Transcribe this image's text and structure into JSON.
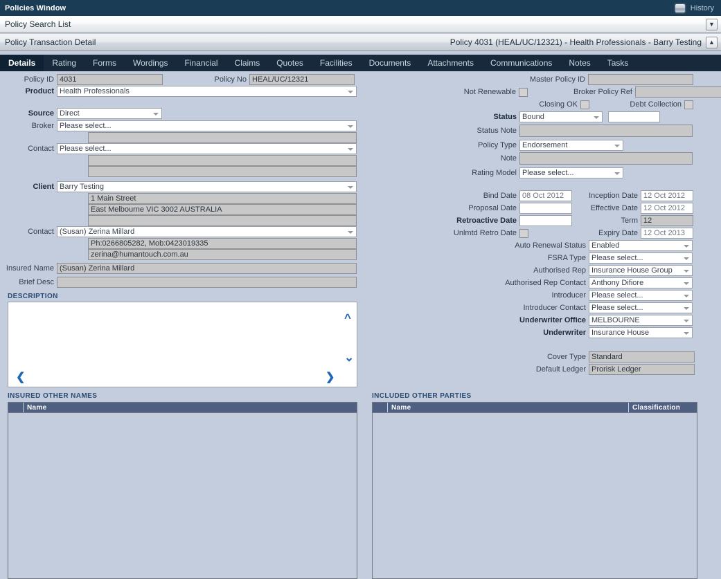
{
  "window": {
    "title": "Policies Window",
    "history_label": "History",
    "history_icon": "window-icon"
  },
  "breadcrumbs": {
    "search_list": "Policy Search List",
    "transaction_detail": "Policy Transaction Detail",
    "policy_title": "Policy 4031 (HEAL/UC/12321) - Health Professionals - Barry Testing",
    "expand_down_icon": "chevron-down-icon",
    "collapse_up_icon": "chevron-up-icon"
  },
  "tabs": [
    {
      "label": "Details",
      "active": true
    },
    {
      "label": "Rating",
      "active": false
    },
    {
      "label": "Forms",
      "active": false
    },
    {
      "label": "Wordings",
      "active": false
    },
    {
      "label": "Financial",
      "active": false
    },
    {
      "label": "Claims",
      "active": false
    },
    {
      "label": "Quotes",
      "active": false
    },
    {
      "label": "Facilities",
      "active": false
    },
    {
      "label": "Documents",
      "active": false
    },
    {
      "label": "Attachments",
      "active": false
    },
    {
      "label": "Communications",
      "active": false
    },
    {
      "label": "Notes",
      "active": false
    },
    {
      "label": "Tasks",
      "active": false
    }
  ],
  "left": {
    "policy_id_label": "Policy ID",
    "policy_id_value": "4031",
    "policy_no_label": "Policy No",
    "policy_no_value": "HEAL/UC/12321",
    "product_label": "Product",
    "product_value": "Health Professionals",
    "source_label": "Source",
    "source_value": "Direct",
    "broker_label": "Broker",
    "broker_value": "Please select...",
    "broker_detail_1": "",
    "contact_label": "Contact",
    "contact_value": "Please select...",
    "contact_detail_1": "",
    "contact_detail_2": "",
    "client_label": "Client",
    "client_value": "Barry Testing",
    "client_addr_1": "1 Main Street",
    "client_addr_2": "East Melbourne VIC 3002 AUSTRALIA",
    "client_addr_3": "",
    "client_contact_label": "Contact",
    "client_contact_value": "(Susan) Zerina Millard",
    "client_contact_phone": "Ph:0266805282, Mob:0423019335",
    "client_contact_email": "zerina@humantouch.com.au",
    "insured_name_label": "Insured Name",
    "insured_name_value": "(Susan) Zerina Millard",
    "brief_desc_label": "Brief Desc",
    "brief_desc_value": ""
  },
  "right": {
    "master_policy_id_label": "Master Policy ID",
    "master_policy_id_value": "",
    "not_renewable_label": "Not Renewable",
    "not_renewable_checked": false,
    "broker_policy_ref_label": "Broker Policy Ref",
    "broker_policy_ref_value": "",
    "closing_ok_label": "Closing OK",
    "closing_ok_checked": false,
    "debt_collection_label": "Debt Collection",
    "debt_collection_checked": false,
    "status_label": "Status",
    "status_value": "Bound",
    "status_extra_value": "",
    "status_note_label": "Status Note",
    "status_note_value": "",
    "policy_type_label": "Policy Type",
    "policy_type_value": "Endorsement",
    "note_label": "Note",
    "note_value": "",
    "rating_model_label": "Rating Model",
    "rating_model_value": "Please select...",
    "bind_date_label": "Bind Date",
    "bind_date_value": "08 Oct 2012",
    "inception_date_label": "Inception Date",
    "inception_date_value": "12 Oct 2012",
    "proposal_date_label": "Proposal Date",
    "proposal_date_value": "",
    "effective_date_label": "Effective Date",
    "effective_date_value": "12 Oct 2012",
    "retroactive_date_label": "Retroactive Date",
    "retroactive_date_value": "",
    "term_label": "Term",
    "term_value": "12",
    "unlmtd_retro_date_label": "Unlmtd Retro Date",
    "unlmtd_retro_date_checked": false,
    "expiry_date_label": "Expiry Date",
    "expiry_date_value": "12 Oct 2013",
    "auto_renewal_status_label": "Auto Renewal Status",
    "auto_renewal_status_value": "Enabled",
    "fsra_type_label": "FSRA Type",
    "fsra_type_value": "Please select...",
    "authorised_rep_label": "Authorised Rep",
    "authorised_rep_value": "Insurance House Group",
    "authorised_rep_contact_label": "Authorised Rep Contact",
    "authorised_rep_contact_value": "Anthony Difiore",
    "introducer_label": "Introducer",
    "introducer_value": "Please select...",
    "introducer_contact_label": "Introducer Contact",
    "introducer_contact_value": "Please select...",
    "underwriter_office_label": "Underwriter Office",
    "underwriter_office_value": "MELBOURNE",
    "underwriter_label": "Underwriter",
    "underwriter_value": "Insurance House",
    "cover_type_label": "Cover Type",
    "cover_type_value": "Standard",
    "default_ledger_label": "Default Ledger",
    "default_ledger_value": "Prorisk Ledger"
  },
  "description": {
    "section_title": "DESCRIPTION",
    "text": "",
    "scroll_up_icon": "chevron-up-icon",
    "scroll_down_icon": "chevron-down-icon",
    "prev_icon": "chevron-left-icon",
    "next_icon": "chevron-right-icon"
  },
  "insured_other_names": {
    "section_title": "INSURED OTHER NAMES",
    "columns": [
      "Name"
    ],
    "rows": []
  },
  "included_other_parties": {
    "section_title": "INCLUDED OTHER PARTIES",
    "columns": [
      "Name",
      "Classification"
    ],
    "rows": []
  },
  "colors": {
    "titlebar": "#1b3c55",
    "tabbar": "#17293a",
    "tab_active": "#0f2233",
    "body": "#c3cdde",
    "grid_header": "#4e5f82",
    "section_title": "#2b4a6f",
    "chevron_blue": "#1f66b5"
  }
}
